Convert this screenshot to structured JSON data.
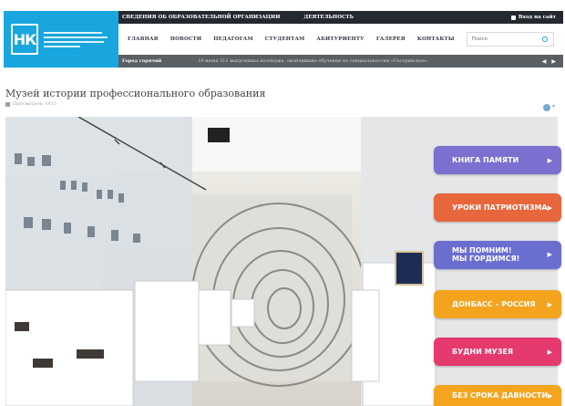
{
  "logo": {
    "mark": "НК"
  },
  "topbar": {
    "items": [
      "СВЕДЕНИЯ ОБ ОБРАЗОВАТЕЛЬНОЙ ОРГАНИЗАЦИИ",
      "ДЕЯТЕЛЬНОСТЬ"
    ],
    "login": "Вход на сайт"
  },
  "nav": {
    "items": [
      "ГЛАВНАЯ",
      "НОВОСТИ",
      "ПЕДАГОГАМ",
      "СТУДЕНТАМ",
      "АБИТУРИЕНТУ",
      "ГАЛЕРЕЯ",
      "КОНТАКТЫ"
    ]
  },
  "search": {
    "placeholder": "Поиск"
  },
  "ticker": {
    "label": "Город горячий",
    "text": "19 июня 311 выпускника колледжа, окончившие обучение по специальностям «Сестринское»"
  },
  "page": {
    "title": "Музей истории профессионального образования",
    "date": "Просмотров: 1415"
  },
  "sidebar_buttons": [
    {
      "label": "КНИГА ПАМЯТИ",
      "color": "#7b6fcf"
    },
    {
      "label": "УРОКИ ПАТРИОТИЗМА",
      "color": "#e8663c"
    },
    {
      "label_line1": "МЫ ПОМНИМ!",
      "label_line2": "МЫ ГОРДИМСЯ!",
      "color": "#6a6fcf"
    },
    {
      "label": "ДОНБАСС – РОССИЯ",
      "color": "#f3a31c"
    },
    {
      "label": "БУДНИ МУЗЕЯ",
      "color": "#e43a6e"
    },
    {
      "label": "БЕЗ СРОКА ДАВНОСТИ",
      "color": "#f5a41d"
    }
  ]
}
